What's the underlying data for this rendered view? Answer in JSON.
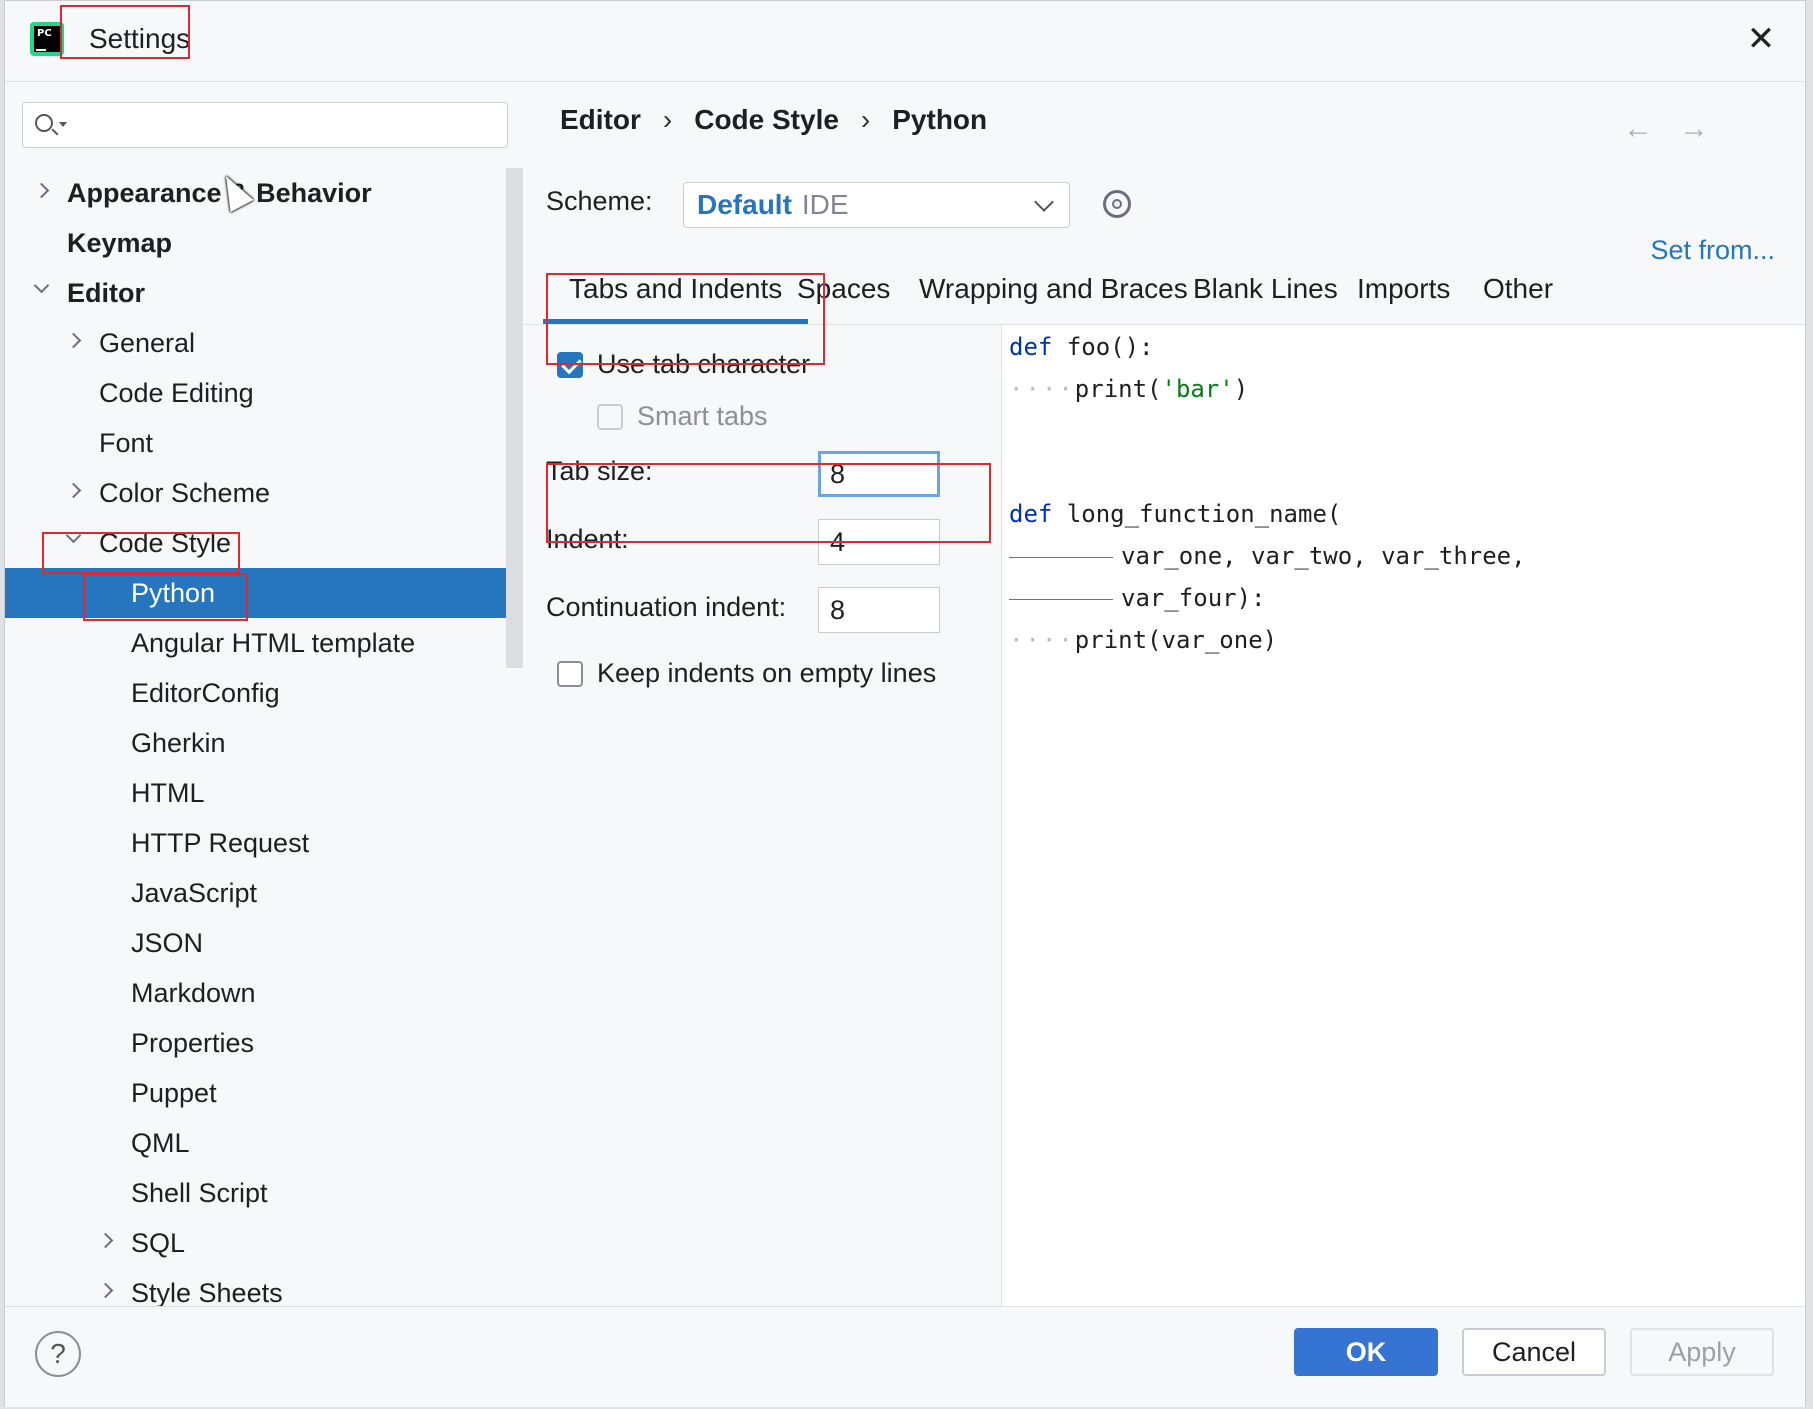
{
  "window": {
    "title": "Settings",
    "close_label": "✕"
  },
  "sidebar": {
    "search": {
      "placeholder": "",
      "value": ""
    },
    "items": [
      {
        "label": "Appearance & Behavior",
        "level": 0,
        "expander": "collapsed",
        "bold": true
      },
      {
        "label": "Keymap",
        "level": 0,
        "expander": "none",
        "bold": true
      },
      {
        "label": "Editor",
        "level": 0,
        "expander": "expanded",
        "bold": true
      },
      {
        "label": "General",
        "level": 1,
        "expander": "collapsed"
      },
      {
        "label": "Code Editing",
        "level": 1,
        "expander": "none"
      },
      {
        "label": "Font",
        "level": 1,
        "expander": "none"
      },
      {
        "label": "Color Scheme",
        "level": 1,
        "expander": "collapsed"
      },
      {
        "label": "Code Style",
        "level": 1,
        "expander": "expanded"
      },
      {
        "label": "Python",
        "level": 2,
        "expander": "none",
        "selected": true
      },
      {
        "label": "Angular HTML template",
        "level": 2,
        "expander": "none"
      },
      {
        "label": "EditorConfig",
        "level": 2,
        "expander": "none"
      },
      {
        "label": "Gherkin",
        "level": 2,
        "expander": "none"
      },
      {
        "label": "HTML",
        "level": 2,
        "expander": "none"
      },
      {
        "label": "HTTP Request",
        "level": 2,
        "expander": "none"
      },
      {
        "label": "JavaScript",
        "level": 2,
        "expander": "none"
      },
      {
        "label": "JSON",
        "level": 2,
        "expander": "none"
      },
      {
        "label": "Markdown",
        "level": 2,
        "expander": "none"
      },
      {
        "label": "Properties",
        "level": 2,
        "expander": "none"
      },
      {
        "label": "Puppet",
        "level": 2,
        "expander": "none"
      },
      {
        "label": "QML",
        "level": 2,
        "expander": "none"
      },
      {
        "label": "Shell Script",
        "level": 2,
        "expander": "none"
      },
      {
        "label": "SQL",
        "level": 2,
        "expander": "collapsed"
      },
      {
        "label": "Style Sheets",
        "level": 2,
        "expander": "collapsed"
      }
    ]
  },
  "main": {
    "breadcrumb": [
      "Editor",
      "Code Style",
      "Python"
    ],
    "breadcrumb_separator": "›",
    "nav": {
      "back": "←",
      "forward": "→"
    },
    "scheme": {
      "label": "Scheme:",
      "name": "Default",
      "tag": "IDE"
    },
    "set_from": "Set from...",
    "tabs": [
      "Tabs and Indents",
      "Spaces",
      "Wrapping and Braces",
      "Blank Lines",
      "Imports",
      "Other"
    ],
    "active_tab": "Tabs and Indents",
    "options": {
      "use_tab_character": {
        "label": "Use tab character",
        "checked": true
      },
      "smart_tabs": {
        "label": "Smart tabs",
        "checked": false,
        "disabled": true
      },
      "tab_size": {
        "label": "Tab size:",
        "value": "8"
      },
      "indent": {
        "label": "Indent:",
        "value": "4"
      },
      "continuation_indent": {
        "label": "Continuation indent:",
        "value": "8"
      },
      "keep_indents": {
        "label": "Keep indents on empty lines",
        "checked": false
      }
    },
    "preview": {
      "l1_kw": "def",
      "l1_rest": "foo():",
      "l2_dots": "····",
      "l2_fn": "print(",
      "l2_str": "'bar'",
      "l2_end": ")",
      "l3_kw": "def",
      "l3_rest": "long_function_name(",
      "l4_rest": "var_one, var_two, var_three,",
      "l5_rest": "var_four):",
      "l6_dots": "····",
      "l6_rest": "print(var_one)"
    }
  },
  "footer": {
    "help": "?",
    "ok": "OK",
    "cancel": "Cancel",
    "apply": "Apply"
  },
  "colors": {
    "accent": "#2675bf",
    "highlight_box": "#e0282e",
    "keyword": "#0033b3",
    "string": "#067d17"
  }
}
